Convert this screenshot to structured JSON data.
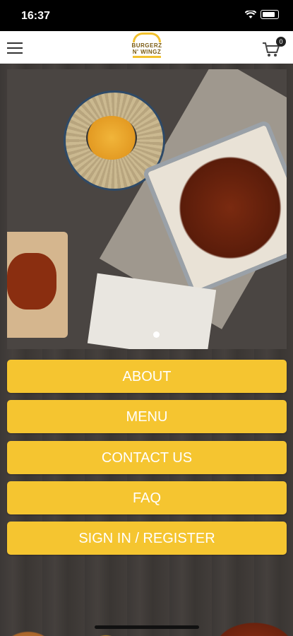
{
  "status_bar": {
    "time": "16:37"
  },
  "header": {
    "logo_line1": "BURGERZ",
    "logo_line2": "N' WINGZ",
    "cart_count": "0"
  },
  "carousel": {
    "current": 2,
    "total": 1
  },
  "nav": {
    "about": "ABOUT",
    "menu": "MENU",
    "contact": "CONTACT US",
    "faq": "FAQ",
    "signin": "SIGN IN / REGISTER"
  },
  "colors": {
    "accent": "#f5c530",
    "header_bg": "#ffffff",
    "status_bg": "#000000"
  }
}
